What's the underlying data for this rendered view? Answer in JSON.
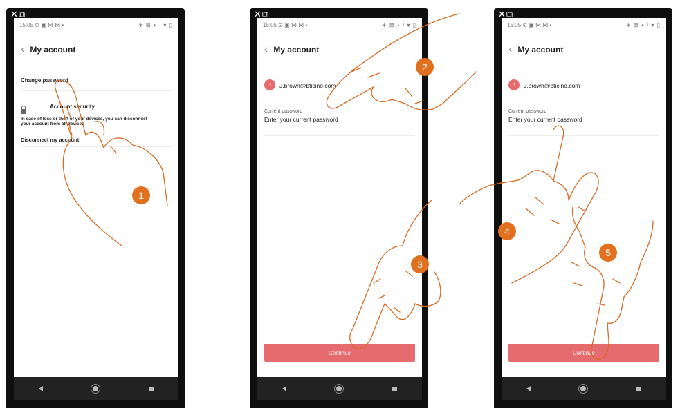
{
  "window_icons": {
    "close": "✕",
    "external": "⧉"
  },
  "status": {
    "time": "15:05",
    "left_icons": "⊙ ▣ ⋈ ⋈ •",
    "right_icons": "∗ ⊠ ◐ ᵎ ▾ ▯"
  },
  "header": {
    "back_icon": "‹",
    "title": "My account"
  },
  "screen1": {
    "change_password": "Change password",
    "account_security": "Account security",
    "security_text_1": "In case of loss or theft of your devices, you can disconnect",
    "security_text_2": "your account from all devices",
    "disconnect": "Disconnect my account"
  },
  "account": {
    "avatar_letter": "J",
    "email": "J.brown@bticino.com"
  },
  "password": {
    "label": "Current password",
    "placeholder": "Enter your current password"
  },
  "continue_label": "Continue",
  "steps": [
    "1",
    "2",
    "3",
    "4",
    "5"
  ],
  "colors": {
    "accent": "#e66b6f",
    "step_badge": "#e1701f"
  }
}
